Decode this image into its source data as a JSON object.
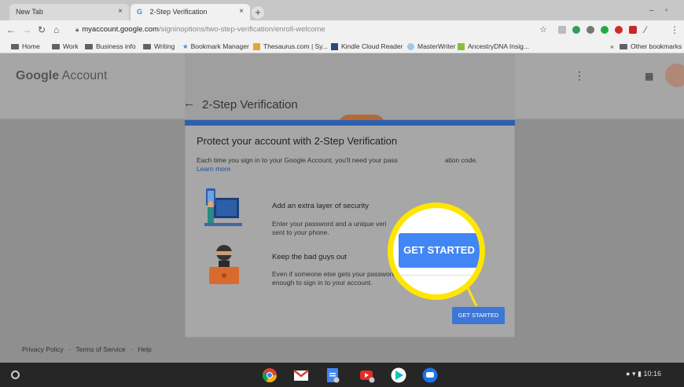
{
  "browser": {
    "tabs": [
      {
        "label": "New Tab",
        "active": false
      },
      {
        "label": "2-Step Verification",
        "active": true
      }
    ],
    "new_tab_symbol": "+",
    "close_symbol": "×",
    "minimize_symbol": "–",
    "url_host": "myaccount.google.com",
    "url_path": "/signinoptions/two-step-verification/enroll-welcome",
    "bookmarks": [
      "Home",
      "Work",
      "Business info",
      "Writing",
      "Bookmark Manager",
      "Thesaurus.com | Sy...",
      "Kindle Cloud Reader",
      "MasterWriter",
      "AncestryDNA Insig..."
    ],
    "other_bookmarks": "Other bookmarks",
    "overflow_symbol": "»"
  },
  "header": {
    "google": "Google",
    "account": " Account",
    "page_title": "2-Step Verification"
  },
  "card": {
    "title": "Protect your account with 2-Step Verification",
    "desc_part1": "Each time you sign in to your Google Account, you'll need your pass",
    "desc_part2": "ation code.",
    "learn_more": "Learn more",
    "feature1_title": "Add an extra layer of security",
    "feature1_desc": "Enter your password and a unique veri",
    "feature1_desc2": "sent to your phone.",
    "feature2_title": "Keep the bad guys out",
    "feature2_desc": "Even if someone else gets your password, it won't be enough to sign in to your account.",
    "button_small": "GET STARTED"
  },
  "highlight": {
    "button_big": "GET STARTED"
  },
  "footer": {
    "privacy": "Privacy Policy",
    "terms": "Terms of Service",
    "help": "Help",
    "separator": "·"
  },
  "shelf": {
    "time": "10:16"
  },
  "colors": {
    "accent_blue": "#4285f4",
    "highlight_yellow": "#ffe600"
  }
}
